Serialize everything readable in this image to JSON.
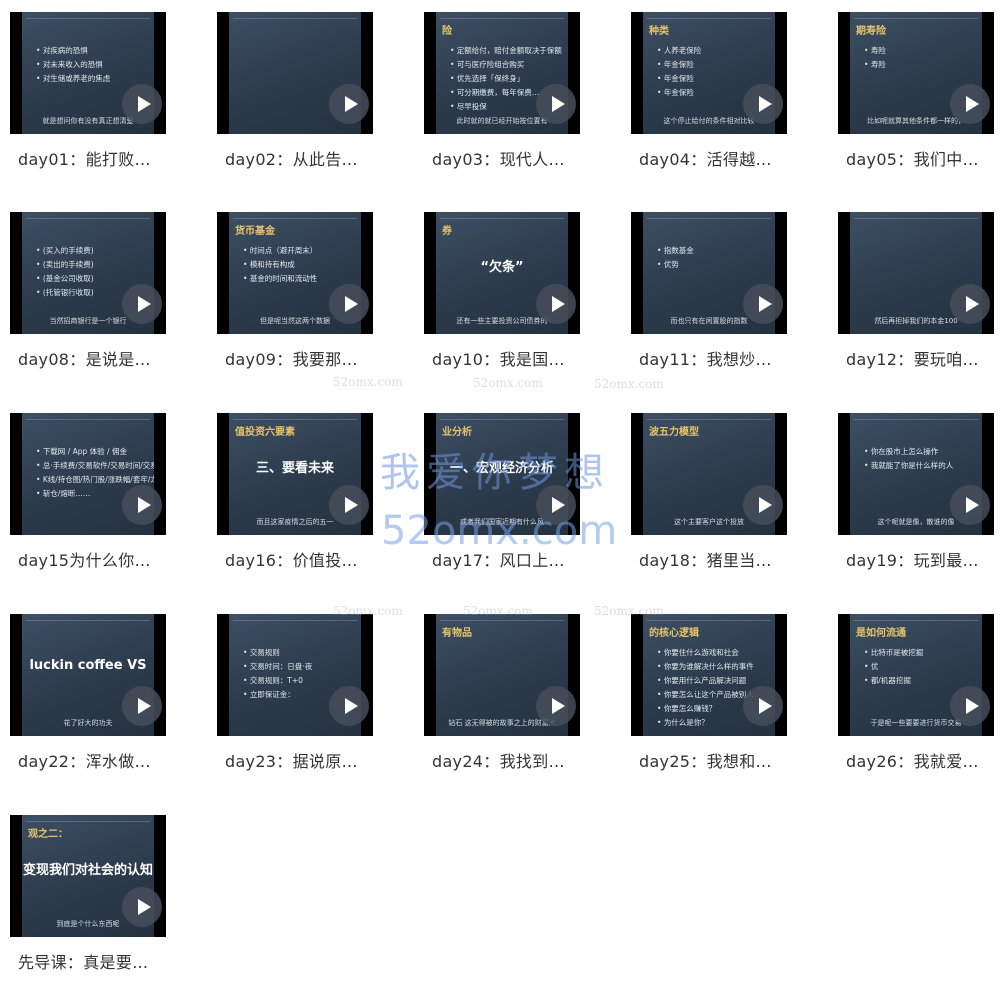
{
  "items": [
    {
      "label": "day01：能打败…",
      "slide_title": "",
      "bullets": [
        "对疾病的恐惧",
        "对未来收入的恐惧",
        "对生储或养老的焦虑"
      ],
      "big": "",
      "caption": "就是想问你有没有真正想清楚"
    },
    {
      "label": "day02：从此告…",
      "slide_title": "",
      "bullets": [],
      "big": "",
      "caption": ""
    },
    {
      "label": "day03：现代人…",
      "slide_title": "险",
      "bullets": [
        "定额给付，赔付金额取决于保额",
        "可与医疗险组合购买",
        "优先选择「保终身」",
        "可分期缴费，每年保费…",
        "尽早投保"
      ],
      "big": "",
      "caption": "此时就的就已经开始按位置有"
    },
    {
      "label": "day04：活得越…",
      "slide_title": "种类",
      "bullets": [
        "人养老保险",
        "年金保险",
        "年金保险",
        "年金保险"
      ],
      "big": "",
      "caption": "这个停止给付的条件相对比较"
    },
    {
      "label": "day05：我们中…",
      "slide_title": "期寿险",
      "bullets": [
        "寿险",
        "寿险"
      ],
      "big": "",
      "caption": "比如呢就算其他条件都一样的，"
    },
    {
      "label": "day08：是说是…",
      "slide_title": "",
      "bullets": [
        "(买入的手续费)",
        "(卖出的手续费)",
        "(基金公司收取)",
        "(托管银行收取)"
      ],
      "big": "",
      "caption": "当然招商银行是一个银行"
    },
    {
      "label": "day09：我要那…",
      "slide_title": "货币基金",
      "bullets": [
        "时间点（避开周末）",
        "模和持有构成",
        "基金的时间和流动性"
      ],
      "big": "",
      "caption": "但是呢当然这两个数据"
    },
    {
      "label": "day10：我是国…",
      "slide_title": "券",
      "bullets": [],
      "big": "“欠条”",
      "caption": "还有一些主要投资公司债券的"
    },
    {
      "label": "day11：我想炒…",
      "slide_title": "",
      "bullets": [
        "指数基金",
        "优势"
      ],
      "big": "",
      "caption": "而也只有在闲置股的指数"
    },
    {
      "label": "day12：要玩咱…",
      "slide_title": "",
      "bullets": [],
      "big": "",
      "caption": "然后再拒掉我们的本金100"
    },
    {
      "label": "day15为什么你…",
      "slide_title": "",
      "bullets": [
        "下载网 / App 体验 / 佣金",
        "总·手续费/交易软件/交易时间/交易规则/集合竞价",
        "K线/持仓图/热门股/涨跌幅/套牢/龙虎榜",
        "斩仓/熔断……"
      ],
      "big": "",
      "caption": ""
    },
    {
      "label": "day16：价值投…",
      "slide_title": "值投资六要素",
      "bullets": [],
      "big": "三、要看未来",
      "caption": "而且这家疫情之后的五一"
    },
    {
      "label": "day17：风口上…",
      "slide_title": "业分析",
      "bullets": [],
      "big": "一、宏观经济分析",
      "caption": "或者我们国家近期有什么风"
    },
    {
      "label": "day18：猪里当…",
      "slide_title": "波五力模型",
      "bullets": [],
      "big": "",
      "caption": "这个主要客户这个投放"
    },
    {
      "label": "day19：玩到最…",
      "slide_title": "",
      "bullets": [
        "你在股市上怎么操作",
        "我就能了你是什么样的人"
      ],
      "big": "",
      "caption": "这个呢就是像，散谁的像"
    },
    {
      "label": "day22：浑水做…",
      "slide_title": "",
      "bullets": [],
      "big": "luckin coffee VS",
      "caption": "花了好大的功夫"
    },
    {
      "label": "day23：据说原…",
      "slide_title": "",
      "bullets": [
        "交易规则",
        "交易时间：日盘·夜",
        "交易规则：T+0",
        "立即保证金："
      ],
      "big": "",
      "caption": ""
    },
    {
      "label": "day24：我找到…",
      "slide_title": "有物品",
      "bullets": [],
      "big": "",
      "caption": "钻石  这无得被的故事之上的财富大"
    },
    {
      "label": "day25：我想和…",
      "slide_title": "的核心逻辑",
      "bullets": [
        "你要住什么游戏和社会",
        "你要为谁解决什么样的事件",
        "你要用什么产品解决问题",
        "你要怎么让这个产品被别人",
        "你要怎么赚钱？",
        "为什么是你？"
      ],
      "big": "",
      "caption": ""
    },
    {
      "label": "day26：我就爱…",
      "slide_title": "是如何流通",
      "bullets": [
        "比特币是被挖掘",
        "优",
        "都/机器挖掘"
      ],
      "big": "",
      "caption": "于是呢一些要要进行货币交易"
    },
    {
      "label": "先导课：真是要…",
      "slide_title": "观之二：",
      "bullets": [],
      "big": "变现我们对社会的认知",
      "caption": "到底是个什么东西呢"
    }
  ],
  "watermark": {
    "text": "我爱你梦想",
    "url": "52omx.com",
    "small": "52omx.com"
  }
}
